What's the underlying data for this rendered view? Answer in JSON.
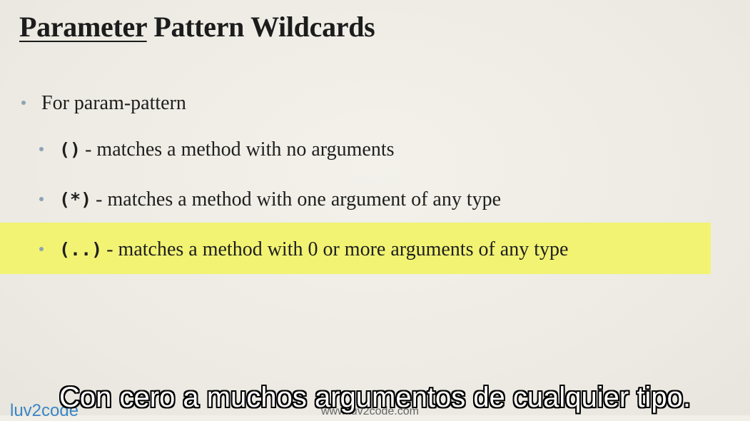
{
  "slide": {
    "title_underlined": "Parameter",
    "title_rest": " Pattern Wildcards",
    "bullets": [
      {
        "code": "",
        "text": "For param-pattern"
      },
      {
        "code": "()",
        "text": "- matches a method with no arguments"
      },
      {
        "code": "(*)",
        "text": "- matches a method with one argument of any type"
      },
      {
        "code": "(..)",
        "text": "- matches a method with 0 or more arguments of any type"
      }
    ],
    "logo_text": "luv2code",
    "website_text": "www.luv2code.com"
  },
  "caption": {
    "text": "Con cero a muchos argumentos de cualquier tipo."
  },
  "colors": {
    "highlight": "#f2f372",
    "bullet_dot": "#8ea3b6",
    "logo": "#3b86c6"
  }
}
